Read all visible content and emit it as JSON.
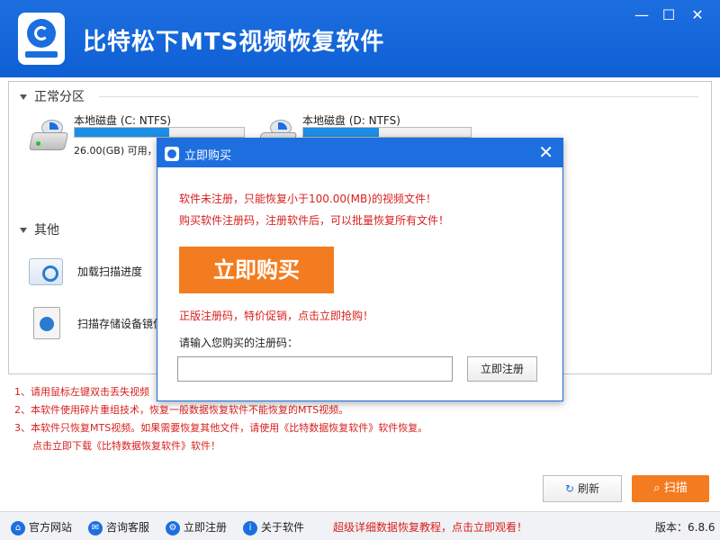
{
  "window": {
    "title": "比特松下MTS视频恢复软件",
    "min": "—",
    "max": "☐",
    "close": "✕"
  },
  "sections": {
    "normal_partitions": "正常分区",
    "others": "其他"
  },
  "disks": [
    {
      "name": "本地磁盘 (C: NTFS)",
      "free": "26.00(GB) 可用，",
      "used_fraction": 0.56
    },
    {
      "name": "本地磁盘 (D: NTFS)",
      "free": "",
      "used_fraction": 0.45
    }
  ],
  "other_items": [
    {
      "label": "加载扫描进度"
    },
    {
      "label": "扫描存储设备镜像"
    }
  ],
  "notes": [
    "1、请用鼠标左键双击丢失视频",
    "2、本软件使用碎片重组技术，恢复一般数据恢复软件不能恢复的MTS视频。",
    "3、本软件只恢复MTS视频。如果需要恢复其他文件，请使用《比特数据恢复软件》软件恢复。",
    "点击立即下载《比特数据恢复软件》软件！"
  ],
  "buttons": {
    "refresh": "刷新",
    "scan": "扫描"
  },
  "statusbar": {
    "website": "官方网站",
    "support": "咨询客服",
    "register": "立即注册",
    "about": "关于软件",
    "promo": "超级详细数据恢复教程，点击立即观看！",
    "version": "版本：6.8.6"
  },
  "modal": {
    "title": "立即购买",
    "warning_line1": "软件未注册，只能恢复小于100.00(MB)的视频文件！",
    "warning_line2": "购买软件注册码，注册软件后，可以批量恢复所有文件！",
    "buy_button": "立即购买",
    "promo": "正版注册码，特价促销，点击立即抢购！",
    "reg_label": "请输入您购买的注册码：",
    "reg_value": "",
    "reg_button": "立即注册"
  },
  "colors": {
    "brand_blue": "#1d6fe0",
    "accent_orange": "#f47c20",
    "warning_red": "#d8201e"
  }
}
